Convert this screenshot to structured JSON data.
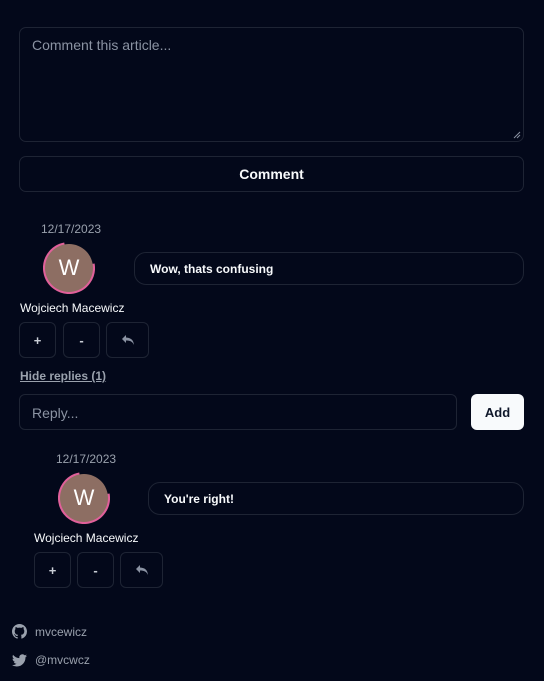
{
  "comment_form": {
    "placeholder": "Comment this article...",
    "submit_label": "Comment"
  },
  "comments": [
    {
      "date": "12/17/2023",
      "avatar_letter": "W",
      "text": "Wow, thats confusing",
      "author": "Wojciech Macewicz",
      "upvote_label": "+",
      "downvote_label": "-"
    }
  ],
  "hide_replies_label": "Hide replies (1)",
  "reply_form": {
    "placeholder": "Reply...",
    "add_label": "Add"
  },
  "replies": [
    {
      "date": "12/17/2023",
      "avatar_letter": "W",
      "text": "You're right!",
      "author": "Wojciech Macewicz",
      "upvote_label": "+",
      "downvote_label": "-"
    }
  ],
  "footer": {
    "github": "mvcewicz",
    "twitter": "@mvcwcz"
  },
  "colors": {
    "background": "#03081a",
    "border": "#1e2434",
    "avatar": "#8d6e63",
    "avatar_ring": "#e0609a"
  }
}
